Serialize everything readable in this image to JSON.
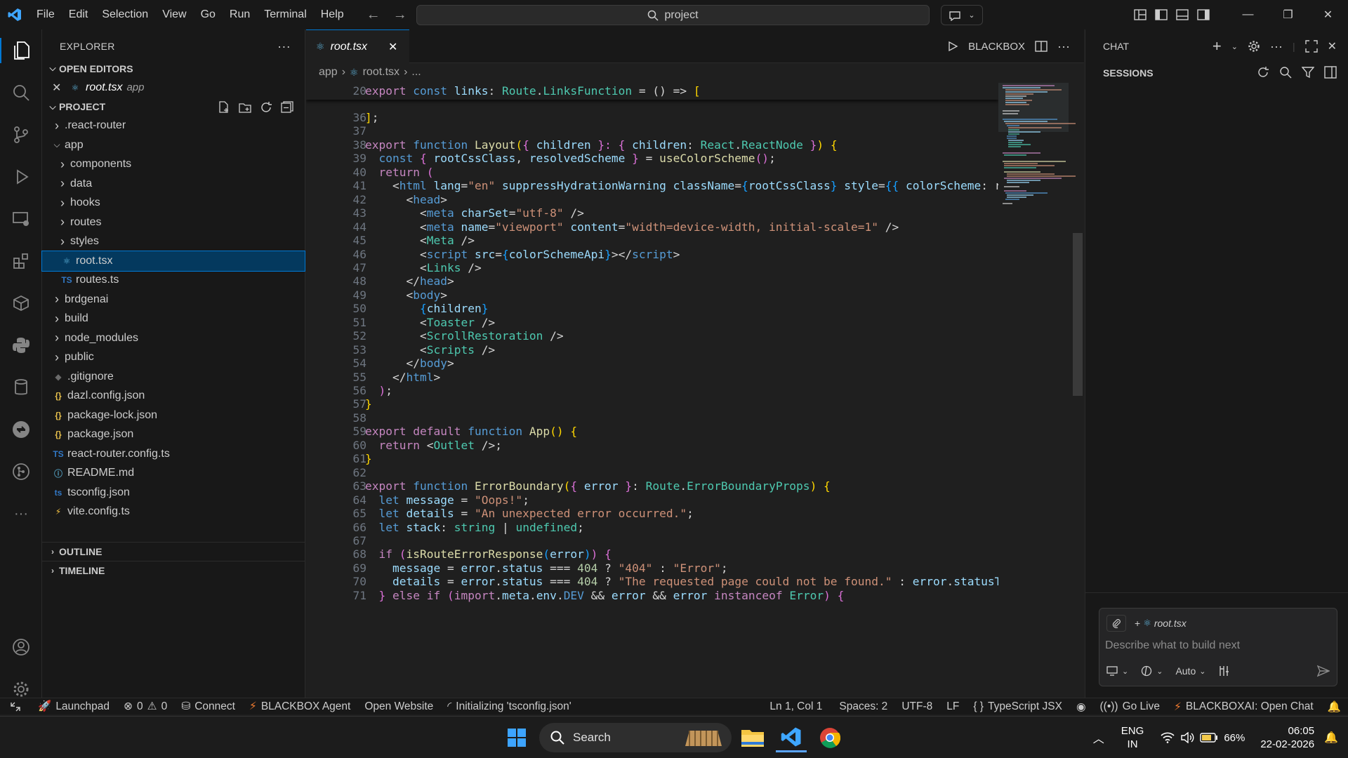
{
  "titlebar": {
    "menus": [
      "File",
      "Edit",
      "Selection",
      "View",
      "Go",
      "Run",
      "Terminal",
      "Help"
    ],
    "search_text": "project"
  },
  "explorer": {
    "title": "EXPLORER",
    "open_editors_label": "OPEN EDITORS",
    "open_editor": {
      "name": "root.tsx",
      "folder": "app"
    },
    "project_label": "PROJECT",
    "tree": [
      {
        "label": ".react-router",
        "kind": "folder",
        "depth": 0,
        "expanded": false
      },
      {
        "label": "app",
        "kind": "folder",
        "depth": 0,
        "expanded": true
      },
      {
        "label": "components",
        "kind": "folder",
        "depth": 1,
        "expanded": false
      },
      {
        "label": "data",
        "kind": "folder",
        "depth": 1,
        "expanded": false
      },
      {
        "label": "hooks",
        "kind": "folder",
        "depth": 1,
        "expanded": false
      },
      {
        "label": "routes",
        "kind": "folder",
        "depth": 1,
        "expanded": false
      },
      {
        "label": "styles",
        "kind": "folder",
        "depth": 1,
        "expanded": false
      },
      {
        "label": "root.tsx",
        "kind": "react",
        "depth": 1,
        "selected": true
      },
      {
        "label": "routes.ts",
        "kind": "ts",
        "depth": 1
      },
      {
        "label": "brdgenai",
        "kind": "folder",
        "depth": 0,
        "expanded": false
      },
      {
        "label": "build",
        "kind": "folder",
        "depth": 0,
        "expanded": false
      },
      {
        "label": "node_modules",
        "kind": "folder",
        "depth": 0,
        "expanded": false
      },
      {
        "label": "public",
        "kind": "folder",
        "depth": 0,
        "expanded": false
      },
      {
        "label": ".gitignore",
        "kind": "git",
        "depth": 0
      },
      {
        "label": "dazl.config.json",
        "kind": "json",
        "depth": 0
      },
      {
        "label": "package-lock.json",
        "kind": "json",
        "depth": 0
      },
      {
        "label": "package.json",
        "kind": "json",
        "depth": 0
      },
      {
        "label": "react-router.config.ts",
        "kind": "ts",
        "depth": 0
      },
      {
        "label": "README.md",
        "kind": "info",
        "depth": 0
      },
      {
        "label": "tsconfig.json",
        "kind": "tsconfig",
        "depth": 0
      },
      {
        "label": "vite.config.ts",
        "kind": "vite",
        "depth": 0
      }
    ],
    "outline_label": "OUTLINE",
    "timeline_label": "TIMELINE"
  },
  "editor": {
    "tab_name": "root.tsx",
    "run_label": "BLACKBOX",
    "breadcrumb": [
      "app",
      "root.tsx",
      "..."
    ],
    "sticky_line": {
      "n": "20",
      "t": [
        [
          "export ",
          "kw"
        ],
        [
          "const ",
          "st"
        ],
        [
          "links",
          "vr"
        ],
        [
          ": ",
          "p"
        ],
        [
          "Route",
          "ty"
        ],
        [
          ".",
          "p"
        ],
        [
          "LinksFunction",
          "ty"
        ],
        [
          " = () => ",
          "p"
        ],
        [
          "[",
          "br1"
        ]
      ]
    },
    "lines": [
      {
        "n": "36",
        "t": [
          [
            "]",
            "br1"
          ],
          [
            ";",
            "p"
          ]
        ]
      },
      {
        "n": "37",
        "t": []
      },
      {
        "n": "38",
        "t": [
          [
            "export ",
            "kw"
          ],
          [
            "function ",
            "st"
          ],
          [
            "Layout",
            "fn"
          ],
          [
            "(",
            "br1"
          ],
          [
            "{ ",
            "br2"
          ],
          [
            "children ",
            "vr"
          ],
          [
            "}: ",
            "br2"
          ],
          [
            "{ ",
            "br2"
          ],
          [
            "children",
            "vr"
          ],
          [
            ": ",
            "p"
          ],
          [
            "React",
            "ty"
          ],
          [
            ".",
            "p"
          ],
          [
            "ReactNode ",
            "ty"
          ],
          [
            "}",
            "br2"
          ],
          [
            ")",
            "br1"
          ],
          [
            " {",
            "br1"
          ]
        ]
      },
      {
        "n": "39",
        "t": [
          [
            "  const ",
            "st"
          ],
          [
            "{ ",
            "br2"
          ],
          [
            "rootCssClass",
            "vr"
          ],
          [
            ", ",
            "p"
          ],
          [
            "resolvedScheme ",
            "vr"
          ],
          [
            "} ",
            "br2"
          ],
          [
            "= ",
            "p"
          ],
          [
            "useColorScheme",
            "fn"
          ],
          [
            "()",
            "br2"
          ],
          [
            ";",
            "p"
          ]
        ]
      },
      {
        "n": "40",
        "t": [
          [
            "  return ",
            "kw"
          ],
          [
            "(",
            "br2"
          ]
        ]
      },
      {
        "n": "41",
        "t": [
          [
            "    <",
            "p"
          ],
          [
            "html ",
            "tg"
          ],
          [
            "lang",
            "at"
          ],
          [
            "=",
            "p"
          ],
          [
            "\"en\" ",
            "sr"
          ],
          [
            "suppressHydrationWarning ",
            "at"
          ],
          [
            "className",
            "at"
          ],
          [
            "=",
            "p"
          ],
          [
            "{",
            "br3"
          ],
          [
            "rootCssClass",
            "vr"
          ],
          [
            "} ",
            "br3"
          ],
          [
            "style",
            "at"
          ],
          [
            "=",
            "p"
          ],
          [
            "{{ ",
            "br3"
          ],
          [
            "colorScheme",
            "vr"
          ],
          [
            ": re",
            "p"
          ]
        ]
      },
      {
        "n": "42",
        "t": [
          [
            "      <",
            "p"
          ],
          [
            "head",
            "tg"
          ],
          [
            ">",
            "p"
          ]
        ]
      },
      {
        "n": "43",
        "t": [
          [
            "        <",
            "p"
          ],
          [
            "meta ",
            "tg"
          ],
          [
            "charSet",
            "at"
          ],
          [
            "=",
            "p"
          ],
          [
            "\"utf-8\" ",
            "sr"
          ],
          [
            "/>",
            "p"
          ]
        ]
      },
      {
        "n": "44",
        "t": [
          [
            "        <",
            "p"
          ],
          [
            "meta ",
            "tg"
          ],
          [
            "name",
            "at"
          ],
          [
            "=",
            "p"
          ],
          [
            "\"viewport\" ",
            "sr"
          ],
          [
            "content",
            "at"
          ],
          [
            "=",
            "p"
          ],
          [
            "\"width=device-width, initial-scale=1\" ",
            "sr"
          ],
          [
            "/>",
            "p"
          ]
        ]
      },
      {
        "n": "45",
        "t": [
          [
            "        <",
            "p"
          ],
          [
            "Meta ",
            "cm"
          ],
          [
            "/>",
            "p"
          ]
        ]
      },
      {
        "n": "46",
        "t": [
          [
            "        <",
            "p"
          ],
          [
            "script ",
            "tg"
          ],
          [
            "src",
            "at"
          ],
          [
            "=",
            "p"
          ],
          [
            "{",
            "br3"
          ],
          [
            "colorSchemeApi",
            "vr"
          ],
          [
            "}",
            "br3"
          ],
          [
            "></",
            "p"
          ],
          [
            "script",
            "tg"
          ],
          [
            ">",
            "p"
          ]
        ]
      },
      {
        "n": "47",
        "t": [
          [
            "        <",
            "p"
          ],
          [
            "Links ",
            "cm"
          ],
          [
            "/>",
            "p"
          ]
        ]
      },
      {
        "n": "48",
        "t": [
          [
            "      </",
            "p"
          ],
          [
            "head",
            "tg"
          ],
          [
            ">",
            "p"
          ]
        ]
      },
      {
        "n": "49",
        "t": [
          [
            "      <",
            "p"
          ],
          [
            "body",
            "tg"
          ],
          [
            ">",
            "p"
          ]
        ]
      },
      {
        "n": "50",
        "t": [
          [
            "        {",
            "br3"
          ],
          [
            "children",
            "vr"
          ],
          [
            "}",
            "br3"
          ]
        ]
      },
      {
        "n": "51",
        "t": [
          [
            "        <",
            "p"
          ],
          [
            "Toaster ",
            "cm"
          ],
          [
            "/>",
            "p"
          ]
        ]
      },
      {
        "n": "52",
        "t": [
          [
            "        <",
            "p"
          ],
          [
            "ScrollRestoration ",
            "cm"
          ],
          [
            "/>",
            "p"
          ]
        ]
      },
      {
        "n": "53",
        "t": [
          [
            "        <",
            "p"
          ],
          [
            "Scripts ",
            "cm"
          ],
          [
            "/>",
            "p"
          ]
        ]
      },
      {
        "n": "54",
        "t": [
          [
            "      </",
            "p"
          ],
          [
            "body",
            "tg"
          ],
          [
            ">",
            "p"
          ]
        ]
      },
      {
        "n": "55",
        "t": [
          [
            "    </",
            "p"
          ],
          [
            "html",
            "tg"
          ],
          [
            ">",
            "p"
          ]
        ]
      },
      {
        "n": "56",
        "t": [
          [
            "  )",
            "br2"
          ],
          [
            ";",
            "p"
          ]
        ]
      },
      {
        "n": "57",
        "t": [
          [
            "}",
            "br1"
          ]
        ]
      },
      {
        "n": "58",
        "t": []
      },
      {
        "n": "59",
        "t": [
          [
            "export ",
            "kw"
          ],
          [
            "default ",
            "kw"
          ],
          [
            "function ",
            "st"
          ],
          [
            "App",
            "fn"
          ],
          [
            "() ",
            "br1"
          ],
          [
            "{",
            "br1"
          ]
        ]
      },
      {
        "n": "60",
        "t": [
          [
            "  return ",
            "kw"
          ],
          [
            "<",
            "p"
          ],
          [
            "Outlet ",
            "cm"
          ],
          [
            "/>",
            "p"
          ],
          [
            ";",
            "p"
          ]
        ]
      },
      {
        "n": "61",
        "t": [
          [
            "}",
            "br1"
          ]
        ]
      },
      {
        "n": "62",
        "t": []
      },
      {
        "n": "63",
        "t": [
          [
            "export ",
            "kw"
          ],
          [
            "function ",
            "st"
          ],
          [
            "ErrorBoundary",
            "fn"
          ],
          [
            "(",
            "br1"
          ],
          [
            "{ ",
            "br2"
          ],
          [
            "error ",
            "vr"
          ],
          [
            "}",
            "br2"
          ],
          [
            ": ",
            "p"
          ],
          [
            "Route",
            "ty"
          ],
          [
            ".",
            "p"
          ],
          [
            "ErrorBoundaryProps",
            "ty"
          ],
          [
            ")",
            "br1"
          ],
          [
            " {",
            "br1"
          ]
        ]
      },
      {
        "n": "64",
        "t": [
          [
            "  let ",
            "st"
          ],
          [
            "message ",
            "vr"
          ],
          [
            "= ",
            "p"
          ],
          [
            "\"Oops!\"",
            "sr"
          ],
          [
            ";",
            "p"
          ]
        ]
      },
      {
        "n": "65",
        "t": [
          [
            "  let ",
            "st"
          ],
          [
            "details ",
            "vr"
          ],
          [
            "= ",
            "p"
          ],
          [
            "\"An unexpected error occurred.\"",
            "sr"
          ],
          [
            ";",
            "p"
          ]
        ]
      },
      {
        "n": "66",
        "t": [
          [
            "  let ",
            "st"
          ],
          [
            "stack",
            "vr"
          ],
          [
            ": ",
            "p"
          ],
          [
            "string ",
            "ty"
          ],
          [
            "| ",
            "p"
          ],
          [
            "undefined",
            "ty"
          ],
          [
            ";",
            "p"
          ]
        ]
      },
      {
        "n": "67",
        "t": []
      },
      {
        "n": "68",
        "t": [
          [
            "  if ",
            "kw"
          ],
          [
            "(",
            "br2"
          ],
          [
            "isRouteErrorResponse",
            "fn"
          ],
          [
            "(",
            "br3"
          ],
          [
            "error",
            "vr"
          ],
          [
            ")",
            "br3"
          ],
          [
            ")",
            "br2"
          ],
          [
            " {",
            "br2"
          ]
        ]
      },
      {
        "n": "69",
        "t": [
          [
            "    message ",
            "vr"
          ],
          [
            "= ",
            "p"
          ],
          [
            "error",
            "vr"
          ],
          [
            ".",
            "p"
          ],
          [
            "status ",
            "vr"
          ],
          [
            "=== ",
            "p"
          ],
          [
            "404 ",
            "nm"
          ],
          [
            "? ",
            "p"
          ],
          [
            "\"404\" ",
            "sr"
          ],
          [
            ": ",
            "p"
          ],
          [
            "\"Error\"",
            "sr"
          ],
          [
            ";",
            "p"
          ]
        ]
      },
      {
        "n": "70",
        "t": [
          [
            "    details ",
            "vr"
          ],
          [
            "= ",
            "p"
          ],
          [
            "error",
            "vr"
          ],
          [
            ".",
            "p"
          ],
          [
            "status ",
            "vr"
          ],
          [
            "=== ",
            "p"
          ],
          [
            "404 ",
            "nm"
          ],
          [
            "? ",
            "p"
          ],
          [
            "\"The requested page could not be found.\" ",
            "sr"
          ],
          [
            ": ",
            "p"
          ],
          [
            "error",
            "vr"
          ],
          [
            ".",
            "p"
          ],
          [
            "statusTe",
            "vr"
          ]
        ]
      },
      {
        "n": "71",
        "t": [
          [
            "  } ",
            "br2"
          ],
          [
            "else ",
            "kw"
          ],
          [
            "if ",
            "kw"
          ],
          [
            "(",
            "br2"
          ],
          [
            "import",
            "kw"
          ],
          [
            ".",
            "p"
          ],
          [
            "meta",
            "vr"
          ],
          [
            ".",
            "p"
          ],
          [
            "env",
            "vr"
          ],
          [
            ".",
            "p"
          ],
          [
            "DEV ",
            "st"
          ],
          [
            "&& ",
            "p"
          ],
          [
            "error ",
            "vr"
          ],
          [
            "&& ",
            "p"
          ],
          [
            "error ",
            "vr"
          ],
          [
            "instanceof ",
            "kw"
          ],
          [
            "Error",
            "ty"
          ],
          [
            ") {",
            "br2"
          ]
        ]
      }
    ]
  },
  "chat": {
    "title": "CHAT",
    "sessions_label": "SESSIONS",
    "context_file": "root.tsx",
    "placeholder": "Describe what to build next",
    "mode_label": "Auto"
  },
  "statusbar": {
    "launchpad": "Launchpad",
    "errors": "0",
    "warnings": "0",
    "connect": "Connect",
    "agent": "BLACKBOX Agent",
    "open_website": "Open Website",
    "initializing": "Initializing 'tsconfig.json'",
    "position": "Ln 1, Col 1",
    "spaces": "Spaces: 2",
    "encoding": "UTF-8",
    "eol": "LF",
    "language": "TypeScript JSX",
    "go_live": "Go Live",
    "blackbox_chat": "BLACKBOXAI: Open Chat"
  },
  "taskbar": {
    "search_label": "Search",
    "lang_top": "ENG",
    "lang_bottom": "IN",
    "battery": "66%",
    "time": "06:05",
    "date": "22-02-2026"
  },
  "colors": {
    "accent": "#0078d4",
    "keyword": "#c586c0",
    "storage": "#569cd6",
    "function": "#dcdcaa",
    "type": "#4ec9b0",
    "variable": "#9cdcfe",
    "string": "#ce9178"
  }
}
